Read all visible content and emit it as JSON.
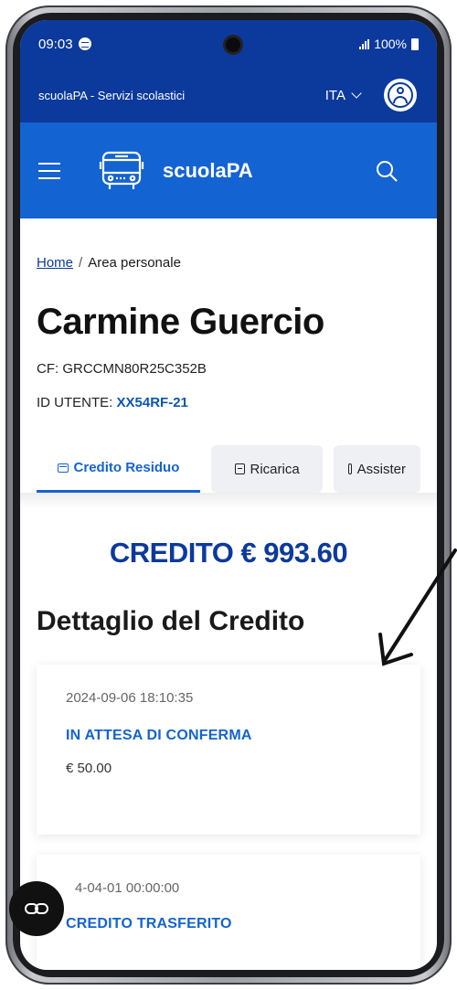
{
  "status_bar": {
    "time": "09:03",
    "battery": "100%"
  },
  "header": {
    "service_title": "scuolaPA - Servizi scolastici",
    "language": "ITA",
    "brand_name": "scuolaPA",
    "icons": [
      "menu-icon",
      "bus-icon",
      "search-icon",
      "user-icon",
      "chevron-down-icon"
    ]
  },
  "breadcrumb": {
    "home": "Home",
    "separator": "/",
    "current": "Area personale"
  },
  "user": {
    "name": "Carmine Guercio",
    "cf_label": "CF:",
    "cf_value": "GRCCMN80R25C352B",
    "id_label": "ID UTENTE:",
    "id_value": "XX54RF-21"
  },
  "tabs": [
    {
      "label": "Credito Residuo",
      "active": true,
      "icon": "wallet-icon"
    },
    {
      "label": "Ricarica",
      "active": false,
      "icon": "document-icon"
    },
    {
      "label": "Assister",
      "active": false,
      "icon": "document-icon"
    }
  ],
  "credit": {
    "total": "CREDITO € 993.60"
  },
  "detail": {
    "title": "Dettaglio del Credito",
    "items": [
      {
        "date": "2024-09-06 18:10:35",
        "status": "IN ATTESA DI CONFERMA",
        "amount": "€ 50.00"
      },
      {
        "date": "4-04-01 00:00:00",
        "status": "CREDITO TRASFERITO"
      }
    ]
  },
  "fab": {
    "icon": "link-icon"
  },
  "colors": {
    "primary_dark": "#0c3a9c",
    "primary": "#1463d2"
  }
}
